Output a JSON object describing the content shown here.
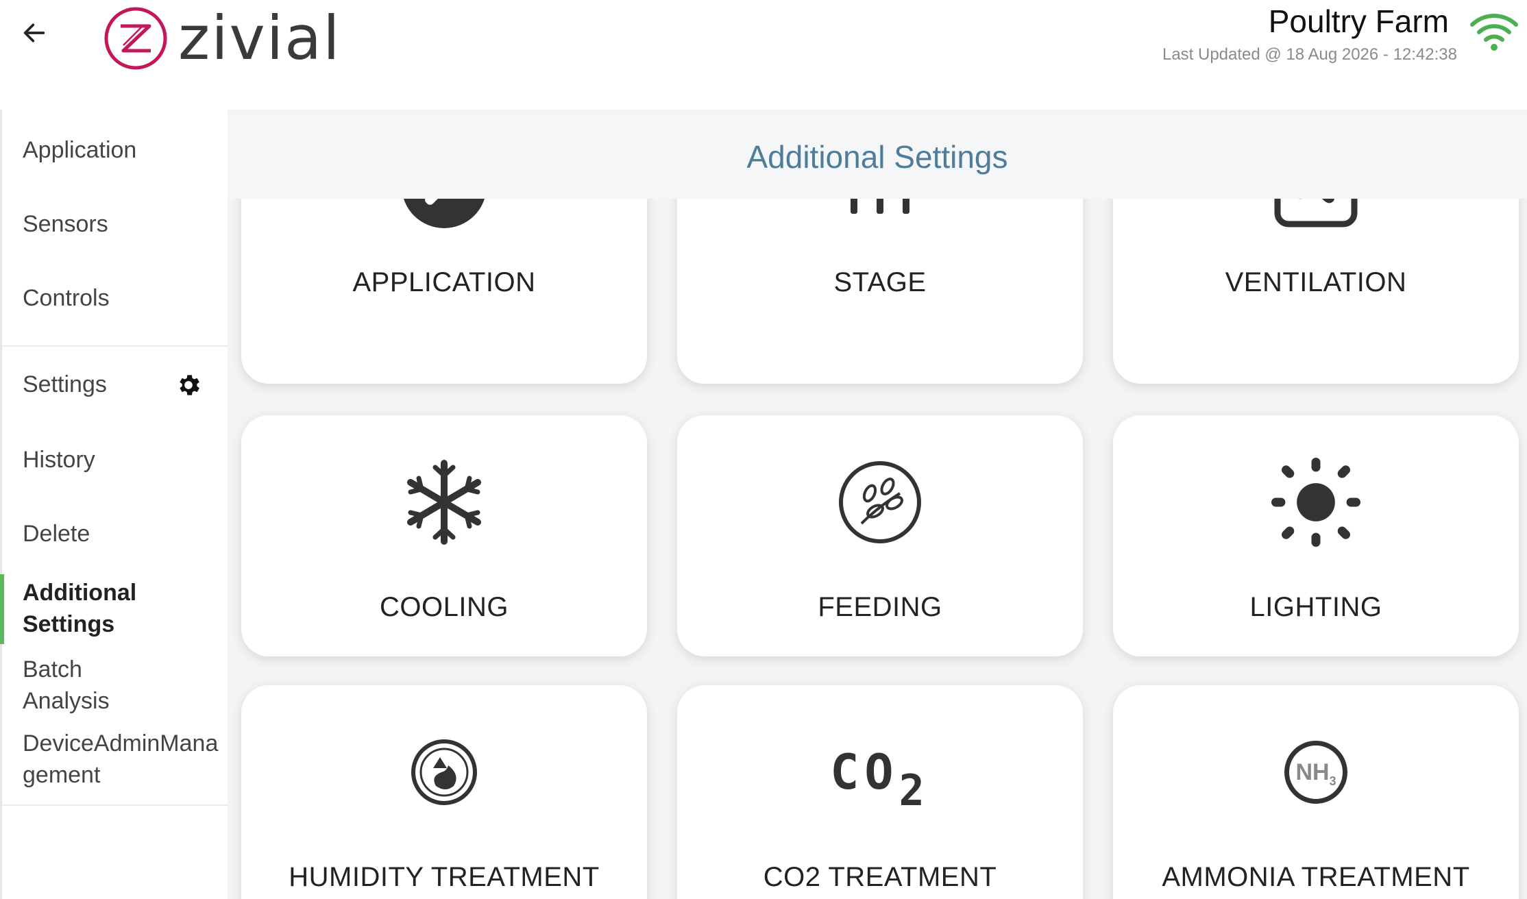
{
  "header": {
    "back_label": "←",
    "logo_text": "zivial",
    "farm_name": "Poultry Farm",
    "last_updated": "Last Updated @ 18 Aug 2026 - 12:42:38"
  },
  "sidebar": {
    "items": [
      {
        "label": "Application"
      },
      {
        "label": "Sensors"
      },
      {
        "label": "Controls"
      },
      {
        "label": "Settings"
      },
      {
        "label": "History"
      },
      {
        "label": "Delete"
      },
      {
        "label_1": "Additional",
        "label_2": "Settings",
        "active": true
      },
      {
        "label_1": "Batch",
        "label_2": "Analysis"
      },
      {
        "label_1": "DeviceAdminMana",
        "label_2": "gement"
      }
    ]
  },
  "main": {
    "title": "Additional Settings",
    "tiles": [
      {
        "label": "APPLICATION",
        "icon": "wrench-icon"
      },
      {
        "label": "STAGE",
        "icon": "stage-icon"
      },
      {
        "label": "VENTILATION",
        "icon": "fan-icon"
      },
      {
        "label": "COOLING",
        "icon": "snowflake-icon"
      },
      {
        "label": "FEEDING",
        "icon": "grain-icon"
      },
      {
        "label": "LIGHTING",
        "icon": "sun-icon"
      },
      {
        "label": "HUMIDITY TREATMENT",
        "icon": "humidity-icon"
      },
      {
        "label": "CO2 TREATMENT",
        "icon": "co2-icon"
      },
      {
        "label": "AMMONIA TREATMENT",
        "icon": "ammonia-icon"
      }
    ],
    "co2_text": "CO",
    "co2_sub": "2",
    "nh_text": "NH",
    "nh_sub": "3"
  },
  "colors": {
    "accent": "#5cb85c",
    "title": "#4f7c99",
    "logo_red": "#c2185b",
    "icon_dark": "#333333"
  }
}
